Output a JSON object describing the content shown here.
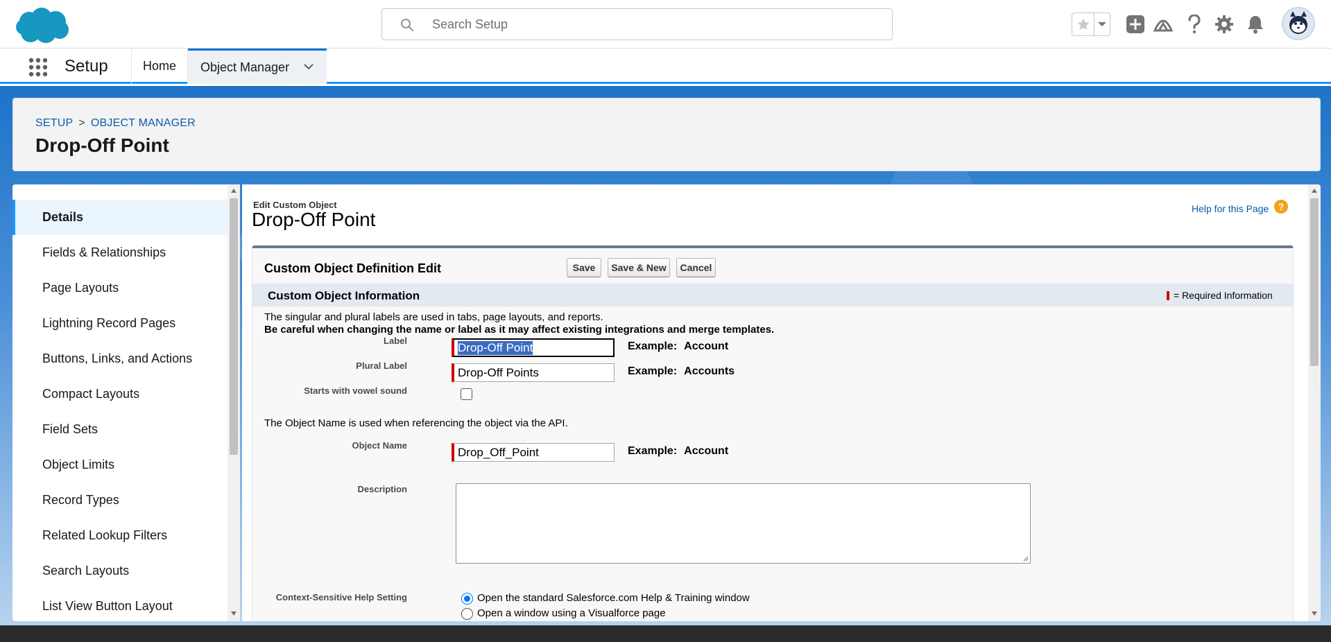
{
  "header": {
    "search_placeholder": "Search Setup",
    "icons": [
      "favorites-star-icon",
      "favorites-dropdown-icon",
      "add-icon",
      "trailhead-icon",
      "help-icon",
      "gear-icon",
      "bell-icon",
      "avatar"
    ]
  },
  "context_nav": {
    "app_name": "Setup",
    "tabs": [
      {
        "label": "Home"
      },
      {
        "label": "Object Manager"
      }
    ]
  },
  "page_header": {
    "breadcrumb": [
      "SETUP",
      "OBJECT MANAGER"
    ],
    "breadcrumb_separator": ">",
    "title": "Drop-Off Point"
  },
  "sidebar": {
    "items": [
      {
        "label": "Details",
        "active": true
      },
      {
        "label": "Fields & Relationships"
      },
      {
        "label": "Page Layouts"
      },
      {
        "label": "Lightning Record Pages"
      },
      {
        "label": "Buttons, Links, and Actions"
      },
      {
        "label": "Compact Layouts"
      },
      {
        "label": "Field Sets"
      },
      {
        "label": "Object Limits"
      },
      {
        "label": "Record Types"
      },
      {
        "label": "Related Lookup Filters"
      },
      {
        "label": "Search Layouts"
      },
      {
        "label": "List View Button Layout"
      }
    ]
  },
  "main": {
    "subtitle": "Edit Custom Object",
    "title": "Drop-Off Point",
    "help_link": "Help for this Page",
    "block_title": "Custom Object Definition Edit",
    "buttons": {
      "save": "Save",
      "save_new": "Save & New",
      "cancel": "Cancel"
    },
    "section_title": "Custom Object Information",
    "required_legend": "= Required Information",
    "intro_line1": "The singular and plural labels are used in tabs, page layouts, and reports.",
    "intro_line2": "Be careful when changing the name or label as it may affect existing integrations and merge templates.",
    "fields": {
      "label": {
        "label": "Label",
        "value": "Drop-Off Point",
        "example_prefix": "Example:",
        "example_value": "Account"
      },
      "plural_label": {
        "label": "Plural Label",
        "value": "Drop-Off Points",
        "example_prefix": "Example:",
        "example_value": "Accounts"
      },
      "vowel": {
        "label": "Starts with vowel sound",
        "checked": false
      },
      "api_note": "The Object Name is used when referencing the object via the API.",
      "object_name": {
        "label": "Object Name",
        "value": "Drop_Off_Point",
        "example_prefix": "Example:",
        "example_value": "Account"
      },
      "description": {
        "label": "Description",
        "value": ""
      },
      "help_setting": {
        "label": "Context-Sensitive Help Setting",
        "options": [
          {
            "label": "Open the standard Salesforce.com Help & Training window",
            "checked": true
          },
          {
            "label": "Open a window using a Visualforce page",
            "checked": false
          }
        ]
      }
    }
  }
}
